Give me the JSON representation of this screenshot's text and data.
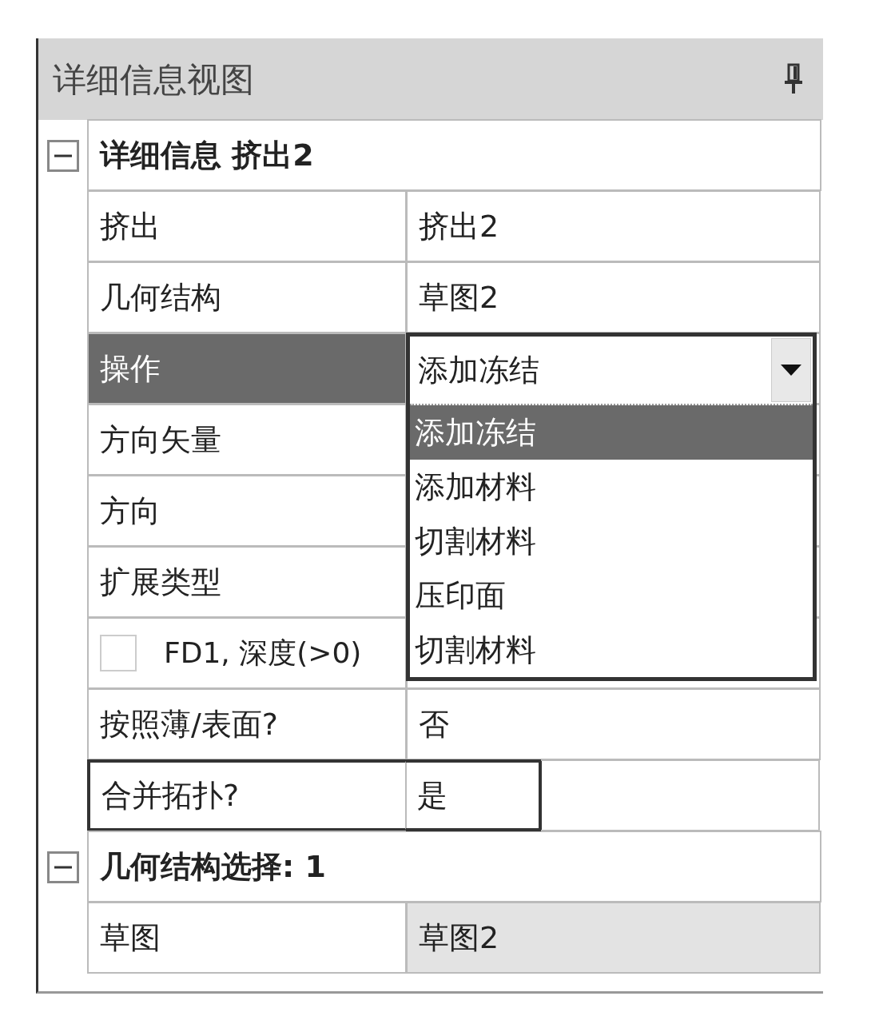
{
  "panel": {
    "title": "详细信息视图"
  },
  "groups": [
    {
      "title": "详细信息 挤出2",
      "expanded": true,
      "rows": [
        {
          "kind": "property",
          "label": "挤出",
          "value": "挤出2",
          "selected": false,
          "focused": false,
          "read_only": false
        },
        {
          "kind": "property",
          "label": "几何结构",
          "value": "草图2",
          "selected": false,
          "focused": false,
          "read_only": false
        },
        {
          "kind": "dropdown",
          "label": "操作",
          "selected": true,
          "focused": false,
          "read_only": false
        },
        {
          "kind": "property",
          "label": "方向矢量",
          "selected": false,
          "focused": false,
          "read_only": false
        },
        {
          "kind": "property",
          "label": "方向",
          "selected": false,
          "focused": false,
          "read_only": false
        },
        {
          "kind": "property",
          "label": "扩展类型",
          "selected": false,
          "focused": false,
          "read_only": false
        },
        {
          "kind": "checkbox",
          "label": "FD1, 深度(>0)",
          "checked": false,
          "selected": false,
          "focused": false,
          "read_only": false
        },
        {
          "kind": "property",
          "label": "按照薄/表面?",
          "value": "否",
          "selected": false,
          "focused": false,
          "read_only": false
        },
        {
          "kind": "property",
          "label": "合并拓扑?",
          "value": "是",
          "selected": false,
          "focused": true,
          "read_only": false
        }
      ]
    },
    {
      "title": "几何结构选择: 1",
      "expanded": true,
      "rows": [
        {
          "kind": "property",
          "label": "草图",
          "value": "草图2",
          "selected": false,
          "focused": false,
          "read_only": true
        }
      ]
    }
  ],
  "dropdown": {
    "value": "添加冻结",
    "options": [
      {
        "label": "添加冻结",
        "selected": true
      },
      {
        "label": "添加材料",
        "selected": false
      },
      {
        "label": "切割材料",
        "selected": false
      },
      {
        "label": "压印面",
        "selected": false
      },
      {
        "label": "切割材料",
        "selected": false
      }
    ]
  }
}
